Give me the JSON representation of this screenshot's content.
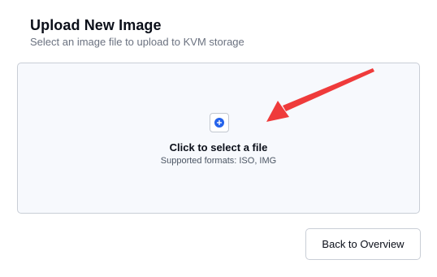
{
  "header": {
    "title": "Upload New Image",
    "subtitle": "Select an image file to upload to KVM storage"
  },
  "dropzone": {
    "icon": "plus-circle-icon",
    "title": "Click to select a file",
    "formats": "Supported formats: ISO, IMG"
  },
  "footer": {
    "back_label": "Back to Overview"
  },
  "colors": {
    "accent": "#2563eb",
    "annotation_arrow": "#ef3b3b",
    "dropzone_bg": "#f7f9fd"
  }
}
